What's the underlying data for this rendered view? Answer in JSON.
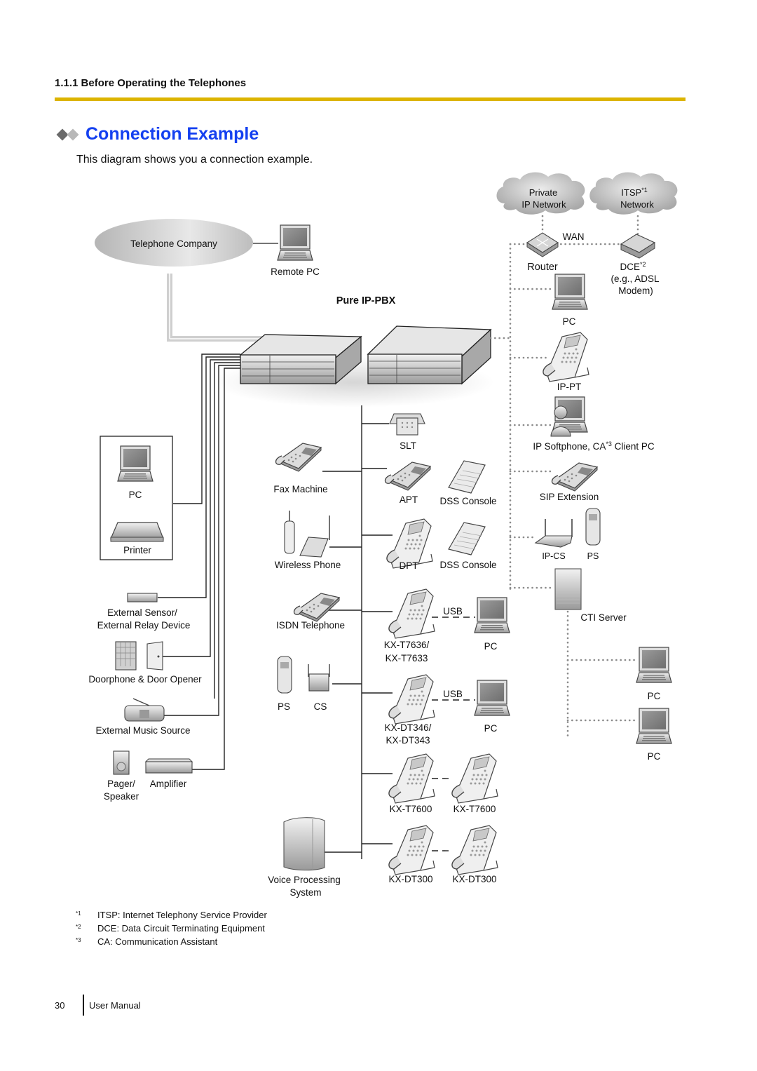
{
  "header": {
    "section": "1.1.1 Before Operating the Telephones",
    "rule_color": "#dcb400"
  },
  "title": {
    "icon": "double-diamond-icon",
    "text": "Connection Example",
    "color": "#1440f0"
  },
  "intro": "This diagram shows you a connection example.",
  "diagram": {
    "pbx_label": "Pure IP-PBX",
    "telephone_company": "Telephone Company",
    "remote_pc": "Remote PC",
    "clouds": {
      "private_line1": "Private",
      "private_line2": "IP Network",
      "itsp_line1": "ITSP",
      "itsp_sup": "*1",
      "itsp_line2": "Network"
    },
    "wan": "WAN",
    "router": "Router",
    "dce": "DCE",
    "dce_sup": "*2",
    "dce_note1": "(e.g., ADSL",
    "dce_note2": "Modem)",
    "right": {
      "pc": "PC",
      "ip_pt": "IP-PT",
      "softphone_a": "IP Softphone, CA",
      "softphone_sup": "*3",
      "softphone_b": " Client PC",
      "sip": "SIP Extension",
      "ip_cs": "IP-CS",
      "ps": "PS",
      "cti": "CTI Server",
      "pc2": "PC",
      "pc3": "PC"
    },
    "left": {
      "pc": "PC",
      "printer": "Printer",
      "sensor1": "External Sensor/",
      "sensor2": "External Relay Device",
      "doorphone": "Doorphone & Door Opener",
      "music": "External Music Source",
      "pager1": "Pager/",
      "pager2": "Speaker",
      "amplifier": "Amplifier"
    },
    "middle": {
      "fax": "Fax Machine",
      "wireless": "Wireless Phone",
      "isdn": "ISDN Telephone",
      "ps": "PS",
      "cs": "CS",
      "vps1": "Voice Processing",
      "vps2": "System"
    },
    "phones": {
      "slt": "SLT",
      "apt": "APT",
      "dss1": "DSS Console",
      "dpt": "DPT",
      "dss2": "DSS Console",
      "usb1": "USB",
      "t7636a": "KX-T7636/",
      "t7636b": "KX-T7633",
      "pc1": "PC",
      "usb2": "USB",
      "dt346a": "KX-DT346/",
      "dt346b": "KX-DT343",
      "pc2": "PC",
      "t7600a": "KX-T7600",
      "t7600b": "KX-T7600",
      "dt300a": "KX-DT300",
      "dt300b": "KX-DT300"
    }
  },
  "footnotes": [
    {
      "mark": "*1",
      "text": "ITSP: Internet Telephony Service Provider"
    },
    {
      "mark": "*2",
      "text": "DCE: Data Circuit Terminating Equipment"
    },
    {
      "mark": "*3",
      "text": "CA: Communication Assistant"
    }
  ],
  "footer": {
    "page_number": "30",
    "doc_name": "User Manual"
  }
}
